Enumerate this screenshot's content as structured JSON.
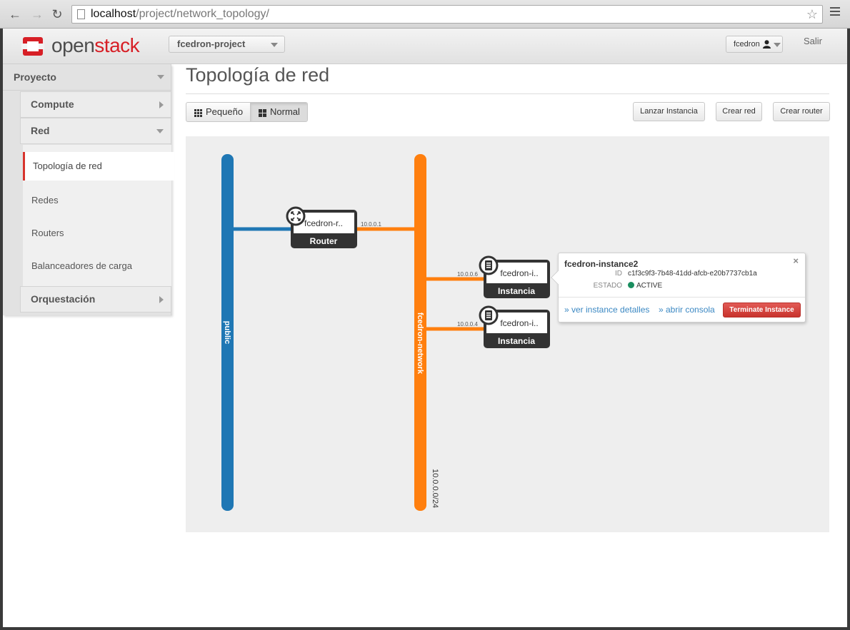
{
  "browser": {
    "url_host": "localhost",
    "url_path": "/project/network_topology/"
  },
  "header": {
    "logo_part1": "open",
    "logo_part2": "stack",
    "project": "fcedron-project",
    "user": "fcedron",
    "logout": "Salir"
  },
  "sidebar": {
    "section": "Proyecto",
    "compute": "Compute",
    "red": "Red",
    "items": [
      {
        "label": "Topología de red",
        "active": true
      },
      {
        "label": "Redes",
        "active": false
      },
      {
        "label": "Routers",
        "active": false
      },
      {
        "label": "Balanceadores de carga",
        "active": false
      }
    ],
    "orquestacion": "Orquestación"
  },
  "main": {
    "title": "Topología de red",
    "view_small": "Pequeño",
    "view_normal": "Normal",
    "launch_instance": "Lanzar Instancia",
    "create_network": "Crear red",
    "create_router": "Crear router"
  },
  "topology": {
    "colors": {
      "public": "#1f77b4",
      "private": "#ff7f0e",
      "node": "#333333"
    },
    "networks": [
      {
        "name": "public",
        "cidr": ""
      },
      {
        "name": "fcedron-network",
        "cidr": "10.0.0.0/24"
      }
    ],
    "router": {
      "name": "fcedron-r..",
      "type": "Router",
      "ip": "10.0.0.1"
    },
    "instances": [
      {
        "name": "fcedron-i..",
        "type": "Instancia",
        "ip": "10.0.0.6"
      },
      {
        "name": "fcedron-i..",
        "type": "Instancia",
        "ip": "10.0.0.4"
      }
    ]
  },
  "popup": {
    "title": "fcedron-instance2",
    "id_label": "ID",
    "id_value": "c1f3c9f3-7b48-41dd-afcb-e20b7737cb1a",
    "status_label": "ESTADO",
    "status_value": "ACTIVE",
    "link_details": "» ver instance detalles",
    "link_console": "» abrir consola",
    "terminate": "Terminate Instance",
    "close": "×"
  }
}
